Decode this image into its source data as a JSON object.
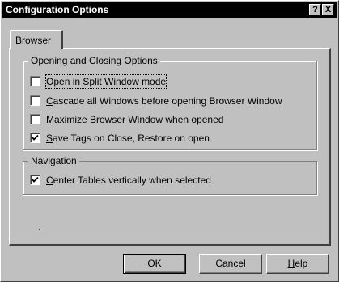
{
  "window": {
    "title": "Configuration Options",
    "help_glyph": "?",
    "close_glyph": "X"
  },
  "tabs": [
    {
      "label": "Browser",
      "selected": true
    }
  ],
  "groups": {
    "opening": {
      "title": "Opening and Closing Options",
      "options": [
        {
          "label_first": "O",
          "label_rest": "pen in Split Window mode",
          "checked": false
        },
        {
          "label_first": "C",
          "label_rest": "ascade all Windows before opening Browser Window",
          "checked": false
        },
        {
          "label_first": "M",
          "label_rest": "aximize Browser Window when opened",
          "checked": false
        },
        {
          "label_first": "S",
          "label_rest": "ave Tags on Close, Restore on open",
          "checked": true
        }
      ]
    },
    "navigation": {
      "title": "Navigation",
      "options": [
        {
          "label_first": "C",
          "label_rest": "enter Tables vertically when selected",
          "checked": true
        }
      ]
    }
  },
  "buttons": {
    "ok": "OK",
    "cancel": "Cancel",
    "help_first": "H",
    "help_rest": "elp"
  },
  "icons": {
    "checkmark": "checkmark-icon",
    "help": "help-icon",
    "close": "close-icon"
  }
}
